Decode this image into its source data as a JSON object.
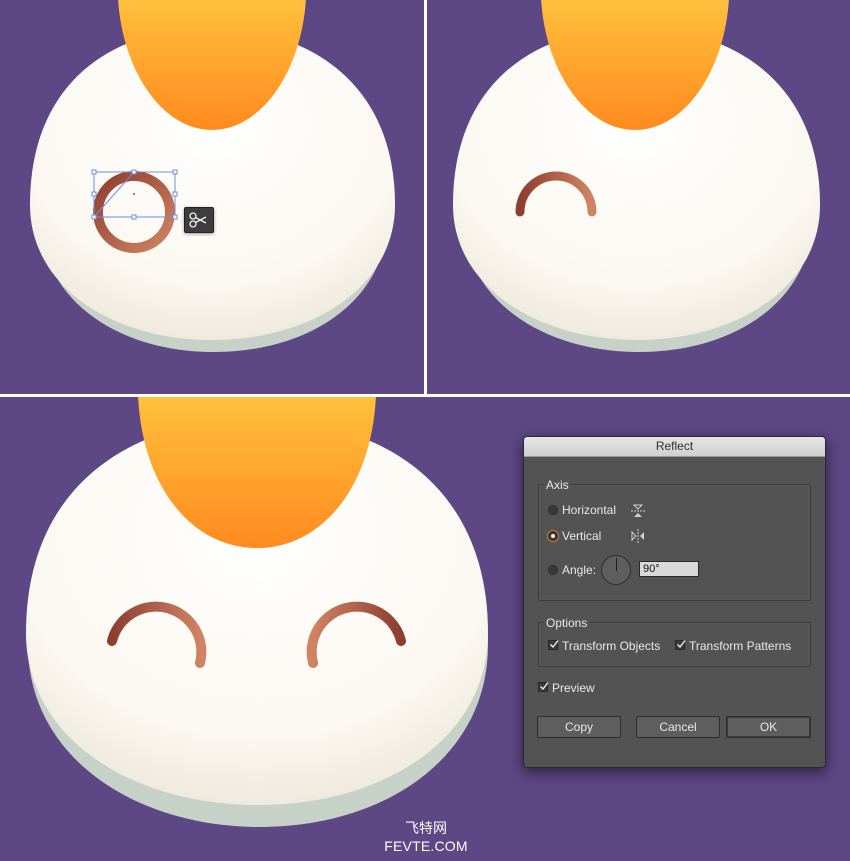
{
  "dialog": {
    "title": "Reflect",
    "axis_label": "Axis",
    "horizontal_label": "Horizontal",
    "vertical_label": "Vertical",
    "selected_axis": "Vertical",
    "angle_label": "Angle:",
    "angle_value": "90°",
    "options_label": "Options",
    "transform_objects_label": "Transform Objects",
    "transform_objects_checked": true,
    "transform_patterns_label": "Transform Patterns",
    "transform_patterns_checked": true,
    "preview_label": "Preview",
    "preview_checked": true,
    "copy_label": "Copy",
    "cancel_label": "Cancel",
    "ok_label": "OK"
  },
  "colors": {
    "background_purple": "#5d4785",
    "yolk_top": "#ffc13d",
    "yolk_bottom": "#ff8a1e",
    "egg_white": "#fbf8f1",
    "egg_shadow": "#c6d1c8",
    "eye_dark": "#8e3e30",
    "eye_light": "#d08463",
    "selection_blue": "#6f8ed9",
    "radio_accent": "#e0783a"
  },
  "icons": {
    "scissors": "scissors-icon",
    "horizontal_axis": "reflect-horizontal-icon",
    "vertical_axis": "reflect-vertical-icon"
  },
  "watermark": {
    "line1": "飞特网",
    "line2": "FEVTE.COM"
  }
}
